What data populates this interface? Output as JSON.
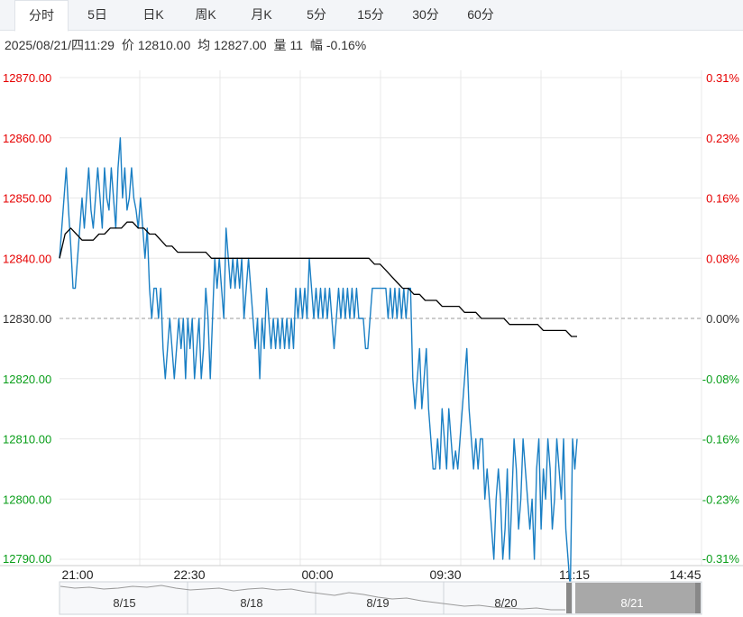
{
  "tabs": [
    {
      "label": "分时",
      "active": true
    },
    {
      "label": "5日",
      "active": false
    },
    {
      "label": "日K",
      "active": false
    },
    {
      "label": "周K",
      "active": false
    },
    {
      "label": "月K",
      "active": false
    },
    {
      "label": "5分",
      "active": false
    },
    {
      "label": "15分",
      "active": false
    },
    {
      "label": "30分",
      "active": false
    },
    {
      "label": "60分",
      "active": false
    }
  ],
  "info": {
    "datetime": "2025/08/21/四11:29",
    "price_label": "价",
    "price": "12810.00",
    "avg_label": "均",
    "avg": "12827.00",
    "volume_label": "量",
    "volume": "11",
    "change_label": "幅",
    "change": "-0.16%"
  },
  "colors": {
    "up": "#e60000",
    "down": "#0a9e1a",
    "price_line": "#1a7fc4",
    "avg_line": "#000000",
    "grid": "#e8e8e8",
    "baseline": "#999999"
  },
  "chart_data": {
    "type": "line",
    "title": "",
    "xlabel": "",
    "ylabel": "",
    "ylim": [
      12790,
      12870
    ],
    "pct_lim": [
      -0.31,
      0.31
    ],
    "base_price": 12830,
    "grid": true,
    "y_ticks": [
      "12870.00",
      "12860.00",
      "12850.00",
      "12840.00",
      "12830.00",
      "12820.00",
      "12810.00",
      "12800.00",
      "12790.00"
    ],
    "pct_ticks": [
      "0.31%",
      "0.23%",
      "0.16%",
      "0.08%",
      "0.00%",
      "-0.08%",
      "-0.16%",
      "-0.23%",
      "-0.31%"
    ],
    "x_ticks": [
      "21:00",
      "22:30",
      "00:00",
      "09:30",
      "11:15",
      "14:45"
    ],
    "session_count": 8,
    "series": [
      {
        "values": [
          12840,
          12845,
          12850,
          12855,
          12848,
          12842,
          12835,
          12835,
          12840,
          12845,
          12850,
          12845,
          12850,
          12855,
          12848,
          12845,
          12850,
          12855,
          12850,
          12845,
          12855,
          12850,
          12848,
          12855,
          12850,
          12845,
          12855,
          12860,
          12850,
          12855,
          12848,
          12850,
          12855,
          12850,
          12848,
          12845,
          12850,
          12845,
          12840,
          12845,
          12835,
          12830,
          12835,
          12835,
          12830,
          12835,
          12825,
          12820,
          12825,
          12830,
          12825,
          12820,
          12825,
          12830,
          12825,
          12830,
          12820,
          12830,
          12825,
          12830,
          12820,
          12825,
          12830,
          12820,
          12825,
          12835,
          12830,
          12820,
          12830,
          12840,
          12835,
          12840,
          12835,
          12830,
          12845,
          12840,
          12835,
          12840,
          12835,
          12840,
          12835,
          12840,
          12830,
          12835,
          12840,
          12835,
          12830,
          12825,
          12830,
          12820,
          12830,
          12825,
          12835,
          12830,
          12825,
          12830,
          12825,
          12830,
          12825,
          12830,
          12825,
          12830,
          12825,
          12830,
          12825,
          12835,
          12830,
          12835,
          12830,
          12835,
          12830,
          12840,
          12835,
          12830,
          12835,
          12830,
          12835,
          12830,
          12835,
          12830,
          12835,
          12830,
          12825,
          12830,
          12835,
          12830,
          12835,
          12830,
          12835,
          12830,
          12835,
          12830,
          12835,
          12830,
          12830,
          12830,
          12825,
          12825,
          12830,
          12835,
          12835,
          12835,
          12835,
          12835,
          12835,
          12835,
          12830,
          12835,
          12830,
          12835,
          12830,
          12835,
          12830,
          12835,
          12830,
          12835,
          12835,
          12820,
          12815,
          12820,
          12825,
          12815,
          12820,
          12825,
          12815,
          12810,
          12805,
          12805,
          12810,
          12805,
          12815,
          12810,
          12805,
          12815,
          12810,
          12805,
          12808,
          12805,
          12810,
          12815,
          12820,
          12825,
          12815,
          12810,
          12805,
          12810,
          12805,
          12810,
          12810,
          12800,
          12805,
          12800,
          12795,
          12790,
          12800,
          12805,
          12800,
          12790,
          12795,
          12805,
          12790,
          12800,
          12810,
          12805,
          12795,
          12800,
          12810,
          12805,
          12800,
          12795,
          12800,
          12790,
          12805,
          12810,
          12795,
          12805,
          12800,
          12810,
          12805,
          12795,
          12800,
          12810,
          12805,
          12800,
          12810,
          12795,
          12790,
          12785,
          12810,
          12805,
          12810
        ]
      },
      {
        "values": [
          12840,
          12844,
          12845,
          12844,
          12843,
          12843,
          12843,
          12844,
          12844,
          12845,
          12845,
          12845,
          12846,
          12846,
          12845,
          12845,
          12844,
          12844,
          12843,
          12842,
          12842,
          12841,
          12841,
          12841,
          12841,
          12841,
          12841,
          12840,
          12840,
          12840,
          12840,
          12840,
          12840,
          12840,
          12840,
          12840,
          12840,
          12840,
          12840,
          12840,
          12840,
          12840,
          12840,
          12840,
          12840,
          12840,
          12840,
          12840,
          12840,
          12840,
          12840,
          12840,
          12840,
          12840,
          12840,
          12840,
          12839,
          12839,
          12838,
          12837,
          12836,
          12835,
          12835,
          12834,
          12834,
          12833,
          12833,
          12833,
          12832,
          12832,
          12832,
          12832,
          12831,
          12831,
          12831,
          12830,
          12830,
          12830,
          12830,
          12830,
          12829,
          12829,
          12829,
          12829,
          12829,
          12829,
          12828,
          12828,
          12828,
          12828,
          12828,
          12827,
          12827
        ]
      }
    ]
  },
  "navigator": {
    "dates": [
      "8/15",
      "8/18",
      "8/19",
      "8/20",
      "8/21"
    ],
    "selected_index": 4
  }
}
